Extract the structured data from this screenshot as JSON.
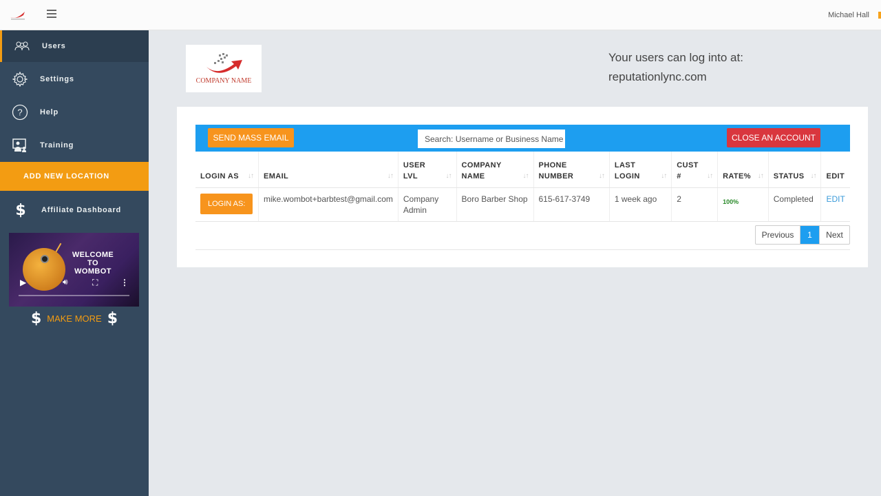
{
  "header": {
    "user_name": "Michael Hall"
  },
  "sidebar": {
    "items": [
      {
        "label": "Users",
        "icon": "users-icon"
      },
      {
        "label": "Settings",
        "icon": "gear-icon"
      },
      {
        "label": "Help",
        "icon": "help-icon"
      },
      {
        "label": "Training",
        "icon": "training-icon"
      }
    ],
    "add_location_label": "ADD NEW LOCATION",
    "affiliate_label": "Affiliate Dashboard",
    "video_title": "WELCOME TO WOMBOT",
    "make_more_label": "MAKE MORE",
    "dollar": "$"
  },
  "main": {
    "logo_text": "COMPANY NAME",
    "login_info_line1": "Your users can log into at:",
    "login_info_line2": "reputationlync.com",
    "toolbar": {
      "mass_email_label": "SEND MASS EMAIL",
      "search_placeholder": "Search: Username or Business Name",
      "close_account_label": "CLOSE AN ACCOUNT"
    },
    "table": {
      "headers": [
        "LOGIN AS",
        "EMAIL",
        "USER LVL",
        "COMPANY NAME",
        "PHONE NUMBER",
        "LAST LOGIN",
        "CUST #",
        "RATE%",
        "STATUS",
        "EDIT"
      ],
      "rows": [
        {
          "login_as": "LOGIN AS:",
          "email": "mike.wombot+barbtest@gmail.com",
          "user_lvl": "Company Admin",
          "company": "Boro Barber Shop",
          "phone": "615-617-3749",
          "last_login": "1 week ago",
          "cust": "2",
          "rate": "100%",
          "status": "Completed",
          "edit": "EDIT"
        }
      ]
    },
    "pagination": {
      "previous": "Previous",
      "current": "1",
      "next": "Next"
    }
  },
  "colors": {
    "sidebar_bg": "#34495e",
    "accent_orange": "#f39c12",
    "toolbar_blue": "#1d9ef0",
    "danger_red": "#d9363e"
  }
}
